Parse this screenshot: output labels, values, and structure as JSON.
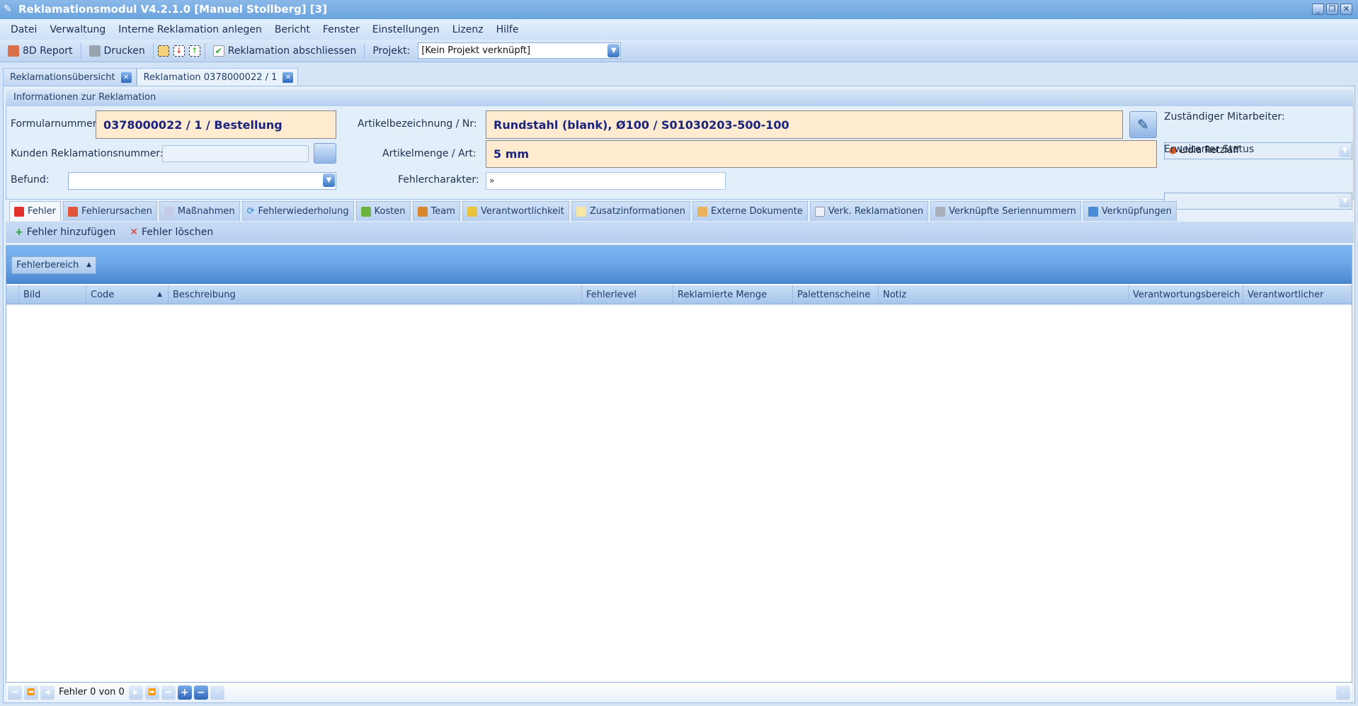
{
  "window": {
    "title": "Reklamationsmodul V4.2.1.0 [Manuel Stollberg] [3]"
  },
  "menu": [
    "Datei",
    "Verwaltung",
    "Interne Reklamation anlegen",
    "Bericht",
    "Fenster",
    "Einstellungen",
    "Lizenz",
    "Hilfe"
  ],
  "toolbar": {
    "report_8d": "8D Report",
    "print": "Drucken",
    "close_claim": "Reklamation abschliessen",
    "project_label": "Projekt:",
    "project_value": "[Kein Projekt verknüpft]"
  },
  "doc_tabs": [
    "Reklamationsübersicht",
    "Reklamation 0378000022 / 1"
  ],
  "info": {
    "header": "Informationen zur Reklamation",
    "form_number_label": "Formularnummer:",
    "form_number": "0378000022 / 1 / Bestellung",
    "customer_claim_label": "Kunden Reklamationsnummer:",
    "customer_claim_value": "",
    "finding_label": "Befund:",
    "finding_value": "",
    "article_label": "Artikelbezeichnung / Nr:",
    "article_value": "Rundstahl (blank), Ø100 / S01030203-500-100",
    "quantity_label": "Artikelmenge / Art:",
    "quantity_value": "5  mm",
    "error_char_label": "Fehlercharakter:",
    "error_char_value": "»",
    "employee_label": "Zuständiger Mitarbeiter:",
    "employee_value": "Lidia Retzlaff",
    "ext_status_label": "Erweiterter Status",
    "ext_status_value": ""
  },
  "detail_tabs": [
    "Fehler",
    "Fehlerursachen",
    "Maßnahmen",
    "Fehlerwiederholung",
    "Kosten",
    "Team",
    "Verantwortlichkeit",
    "Zusatzinformationen",
    "Externe Dokumente",
    "Verk. Reklamationen",
    "Verknüpfte Seriennummern",
    "Verknüpfungen"
  ],
  "subbar": {
    "add": "Fehler hinzufügen",
    "delete": "Fehler löschen"
  },
  "grid": {
    "group_chip": "Fehlerbereich",
    "columns": [
      "Bild",
      "Code",
      "Beschreibung",
      "Fehlerlevel",
      "Reklamierte Menge",
      "Palettenscheine",
      "Notiz",
      "Verantwortungsbereich",
      "Verantwortlicher"
    ],
    "rows": []
  },
  "nav": {
    "record_text": "Fehler 0 von 0"
  }
}
